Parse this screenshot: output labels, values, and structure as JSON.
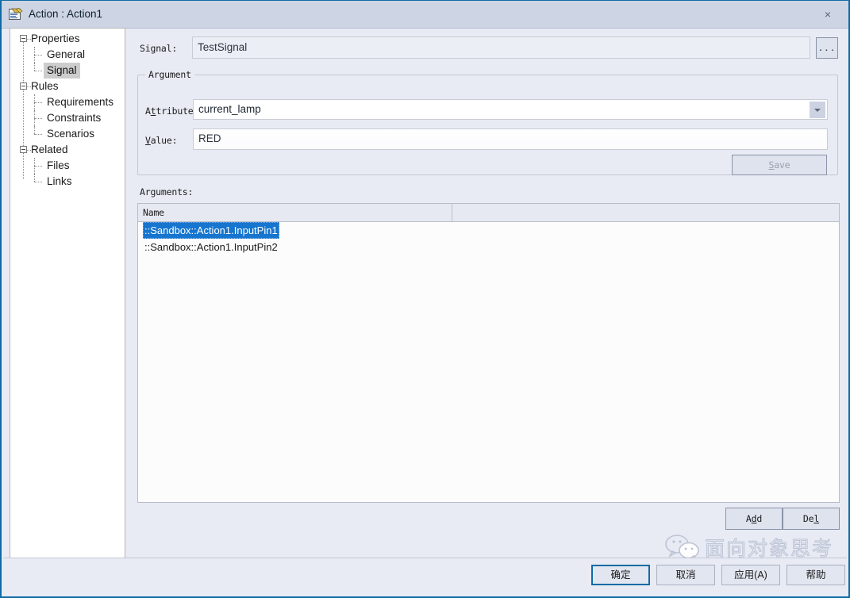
{
  "window": {
    "title": "Action : Action1",
    "icon": "action-document-icon",
    "close_label": "×"
  },
  "tree": {
    "nodes": [
      {
        "label": "Properties",
        "level": 0,
        "expanded": true,
        "selected": false
      },
      {
        "label": "General",
        "level": 1,
        "expanded": false,
        "selected": false
      },
      {
        "label": "Signal",
        "level": 1,
        "expanded": false,
        "selected": true
      },
      {
        "label": "Rules",
        "level": 0,
        "expanded": true,
        "selected": false
      },
      {
        "label": "Requirements",
        "level": 1,
        "expanded": false,
        "selected": false
      },
      {
        "label": "Constraints",
        "level": 1,
        "expanded": false,
        "selected": false
      },
      {
        "label": "Scenarios",
        "level": 1,
        "expanded": false,
        "selected": false
      },
      {
        "label": "Related",
        "level": 0,
        "expanded": true,
        "selected": false
      },
      {
        "label": "Files",
        "level": 1,
        "expanded": false,
        "selected": false
      },
      {
        "label": "Links",
        "level": 1,
        "expanded": false,
        "selected": false
      }
    ]
  },
  "signal": {
    "label_pre": "Si",
    "label_mn": "g",
    "label_post": "nal:",
    "value": "TestSignal",
    "browse_label": "..."
  },
  "argument_group": {
    "title": "Argument",
    "attribute": {
      "label_pre": "A",
      "label_mn": "t",
      "label_post": "tribute",
      "value": "current_lamp"
    },
    "value": {
      "label_pre": "",
      "label_mn": "V",
      "label_post": "alue:",
      "value": "RED"
    },
    "save": {
      "label_pre": "",
      "label_mn": "S",
      "label_post": "ave",
      "enabled": false
    }
  },
  "arguments": {
    "label": "Arguments:",
    "columns": [
      "Name",
      ""
    ],
    "rows": [
      {
        "name": "::Sandbox::Action1.InputPin1",
        "selected": true
      },
      {
        "name": "::Sandbox::Action1.InputPin2",
        "selected": false
      }
    ],
    "add": {
      "label_pre": "A",
      "label_mn": "d",
      "label_post": "d"
    },
    "del": {
      "label_pre": "De",
      "label_mn": "l",
      "label_post": ""
    }
  },
  "footer": {
    "ok": "确定",
    "cancel": "取消",
    "apply": "应用(A)",
    "help": "帮助"
  },
  "watermark": {
    "text": "面向对象思考",
    "icon": "wechat-icon"
  },
  "colors": {
    "accent": "#0f6ba5",
    "selection": "#1675cf",
    "dialog_bg": "#e8ebf4",
    "titlebar": "#cdd4e4"
  }
}
